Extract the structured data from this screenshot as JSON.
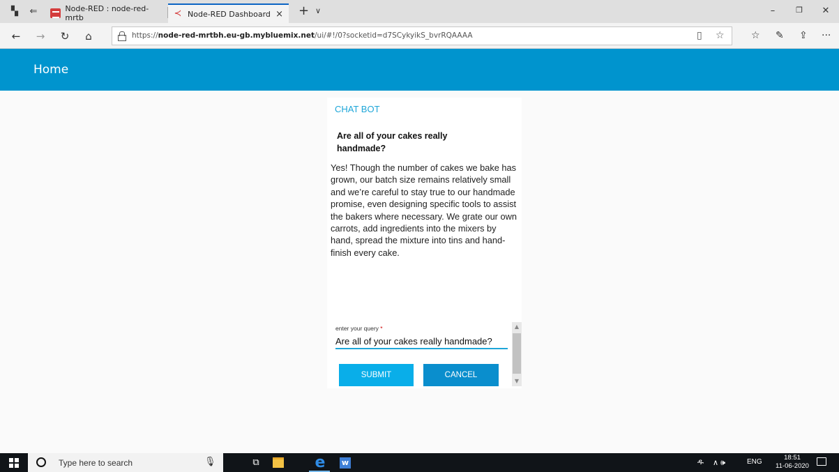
{
  "browser": {
    "tabs": [
      {
        "title": "Node-RED : node-red-mrtb",
        "favicon": "node-red-icon"
      },
      {
        "title": "Node-RED Dashboard",
        "favicon": "node-red-dashboard-icon",
        "close": "×"
      }
    ],
    "new_tab": "+",
    "tab_menu": "∨",
    "window_controls": {
      "minimize": "–",
      "restore": "❐",
      "close": "✕"
    },
    "url_prefix": "https://",
    "url_host": "node-red-mrtbh.eu-gb.mybluemix.net",
    "url_path": "/ui/#!/0?socketid=d7SCykyikS_bvrRQAAAA",
    "nav": {
      "back": "←",
      "forward": "→",
      "refresh": "↻",
      "home": "⌂"
    },
    "toolbar": {
      "reading_view": "▯",
      "favorite": "☆",
      "favorites_hub": "☆",
      "notes": "✎",
      "share": "⇪",
      "more": "···"
    }
  },
  "header": {
    "title": "Home",
    "color": "#0094ce"
  },
  "chat": {
    "title": "CHAT BOT",
    "question": "Are all of your cakes really handmade?",
    "answer": "Yes! Though the number of cakes we bake has grown, our batch size remains relatively small and we’re careful to stay true to our handmade promise, even designing specific tools to assist the bakers where necessary. We grate our own carrots, add ingredients into the mixers by hand, spread the mixture into tins and hand-finish every cake.",
    "input_label": "enter your query",
    "input_required": "*",
    "input_value": "Are all of your cakes really handmade?",
    "submit_label": "SUBMIT",
    "cancel_label": "CANCEL",
    "accent": "#1ea6d8"
  },
  "taskbar": {
    "search_placeholder": "Type here to search",
    "tray_lang": "ENG",
    "tray_icons": "∧ 🕪",
    "person_icon": "ዱ",
    "time": "18:51",
    "date": "11-06-2020"
  }
}
